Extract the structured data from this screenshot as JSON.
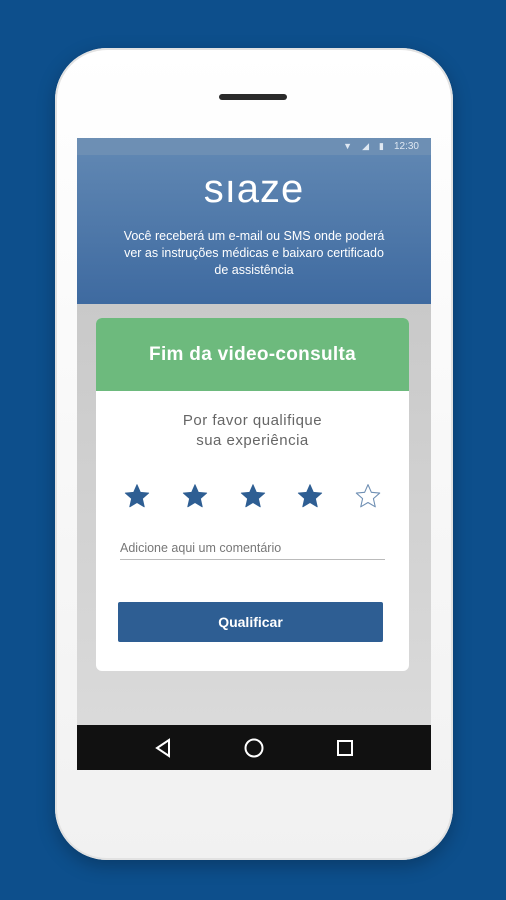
{
  "statusbar": {
    "time": "12:30",
    "icons": [
      "wifi-icon",
      "signal-icon",
      "battery-icon"
    ]
  },
  "header": {
    "logo": "sıaze",
    "message": "Você receberá um e-mail ou SMS onde poderá ver as instruções médicas e baixaro certificado de assistência"
  },
  "card": {
    "title": "Fim da video-consulta",
    "prompt_line1": "Por favor qualifique",
    "prompt_line2": "sua experiência",
    "rating": {
      "value": 4,
      "max": 5
    },
    "comment_placeholder": "Adicione aqui um comentário",
    "button_label": "Qualificar"
  },
  "navbar": {
    "buttons": [
      "back-icon",
      "home-icon",
      "recents-icon"
    ]
  },
  "colors": {
    "background": "#0d4f8c",
    "header": "#4a74a6",
    "card_header": "#6dba7d",
    "button": "#2e5e93",
    "star": "#2e5e93"
  }
}
